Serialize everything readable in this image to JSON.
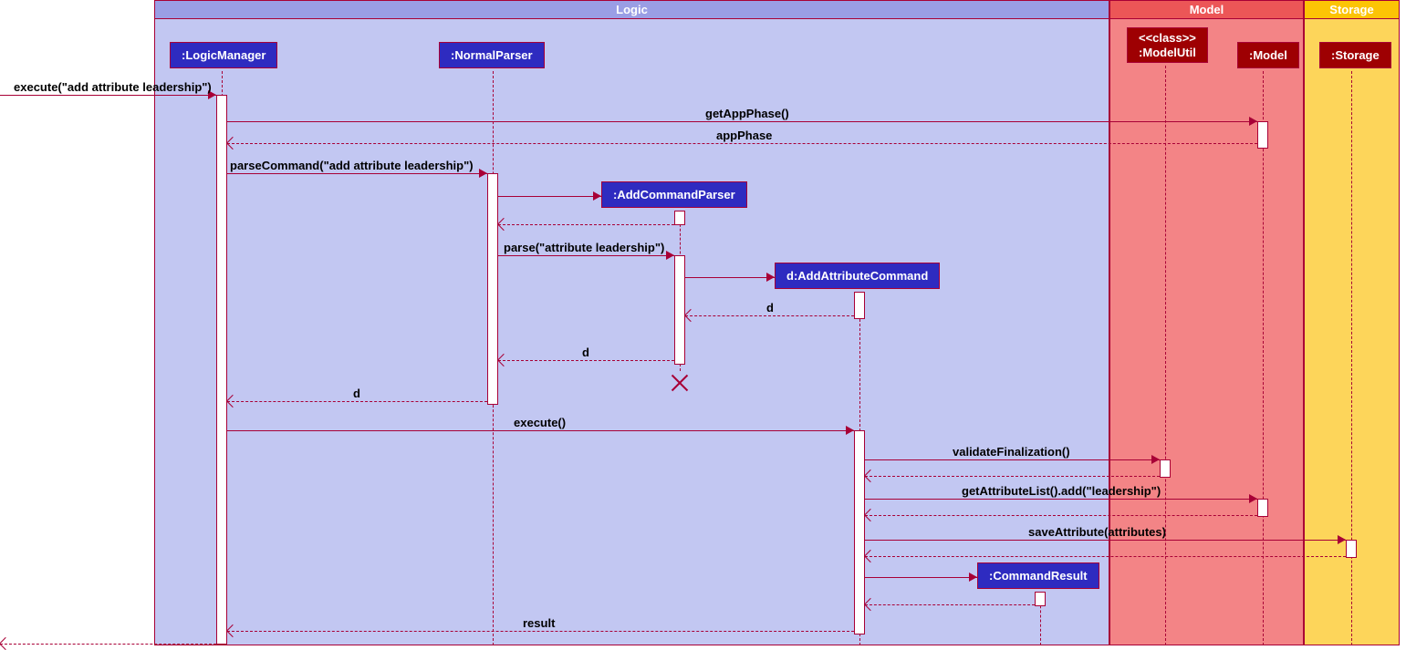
{
  "containers": {
    "logic": "Logic",
    "model": "Model",
    "storage": "Storage"
  },
  "participants": {
    "logicManager": ":LogicManager",
    "normalParser": ":NormalParser",
    "addCommandParser": ":AddCommandParser",
    "addAttributeCommand": "d:AddAttributeCommand",
    "commandResult": ":CommandResult",
    "modelUtilStereo": "<<class>>",
    "modelUtil": ":ModelUtil",
    "model": ":Model",
    "storage": ":Storage"
  },
  "messages": {
    "execute": "execute(\"add attribute leadership\")",
    "getAppPhase": "getAppPhase()",
    "appPhase": "appPhase",
    "parseCommand": "parseCommand(\"add attribute leadership\")",
    "parse": "parse(\"attribute leadership\")",
    "d1": "d",
    "d2": "d",
    "d3": "d",
    "executeCall": "execute()",
    "validateFinalization": "validateFinalization()",
    "getAttributeListAdd": "getAttributeList().add(\"leadership\")",
    "saveAttribute": "saveAttribute(attributes)",
    "result": "result"
  }
}
